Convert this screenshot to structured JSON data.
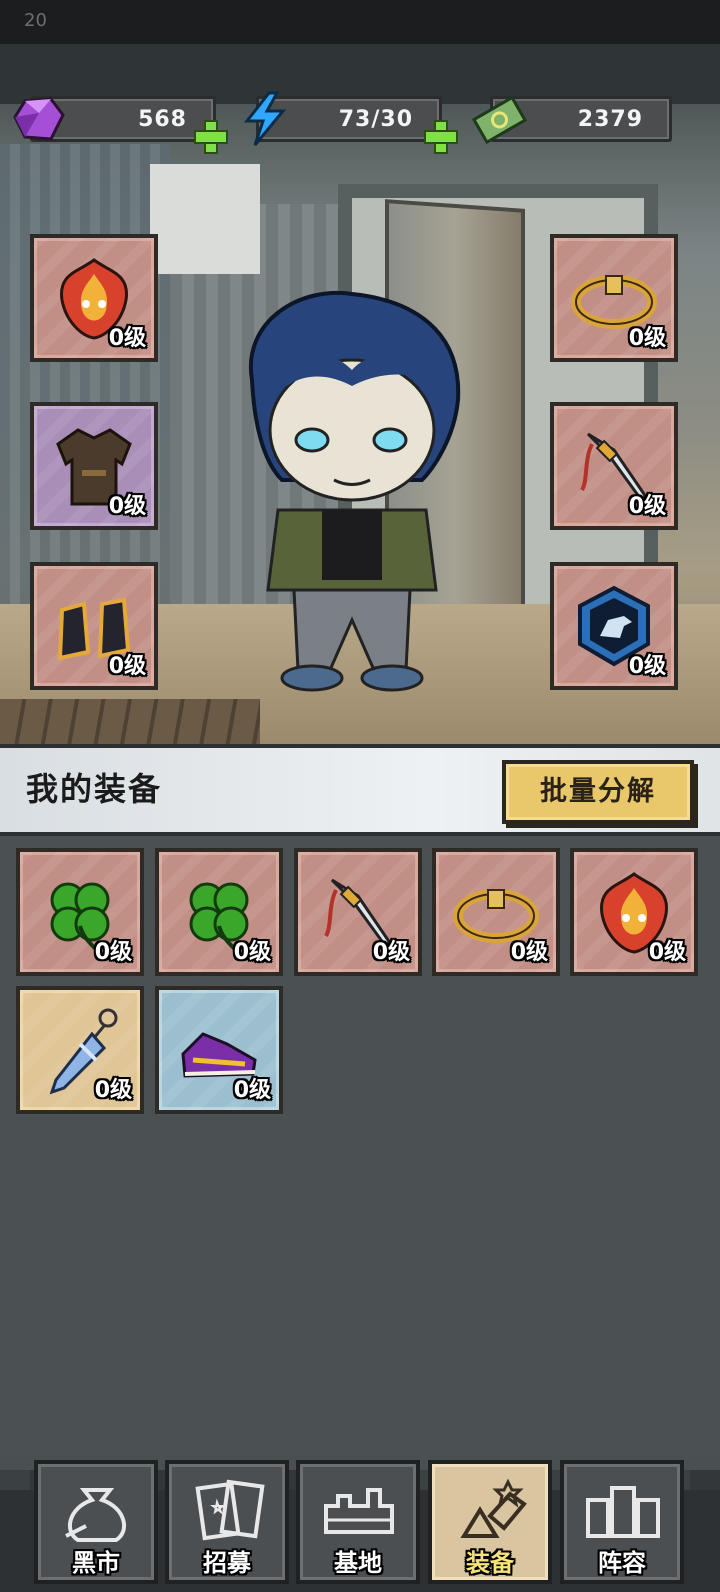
{
  "status_bar": {
    "time": "20"
  },
  "resources": [
    {
      "name": "gems",
      "icon": "purple-gem-icon",
      "value": "568"
    },
    {
      "name": "energy",
      "icon": "lightning-icon",
      "value": "73/30"
    },
    {
      "name": "cash",
      "icon": "banknote-icon",
      "value": "2379"
    }
  ],
  "equipped": {
    "left": [
      {
        "item": "flame-mask",
        "level": "0级",
        "rarity": "red"
      },
      {
        "item": "jacket",
        "level": "0级",
        "rarity": "purple"
      },
      {
        "item": "boots",
        "level": "0级",
        "rarity": "red"
      }
    ],
    "right": [
      {
        "item": "gold-bracelet",
        "level": "0级",
        "rarity": "red"
      },
      {
        "item": "ornate-dagger",
        "level": "0级",
        "rarity": "red"
      },
      {
        "item": "dino-pendant",
        "level": "0级",
        "rarity": "red"
      }
    ]
  },
  "inventory": {
    "title": "我的装备",
    "batch_button": "批量分解",
    "items": [
      {
        "item": "four-leaf-clover",
        "level": "0级",
        "rarity": "red"
      },
      {
        "item": "four-leaf-clover",
        "level": "0级",
        "rarity": "red"
      },
      {
        "item": "ornate-dagger",
        "level": "0级",
        "rarity": "red"
      },
      {
        "item": "gold-bracelet",
        "level": "0级",
        "rarity": "red"
      },
      {
        "item": "flame-mask",
        "level": "0级",
        "rarity": "red"
      },
      {
        "item": "ice-blade-keychain",
        "level": "0级",
        "rarity": "gold"
      },
      {
        "item": "sneakers",
        "level": "0级",
        "rarity": "blue"
      }
    ]
  },
  "nav": {
    "tabs": [
      {
        "label": "黑市",
        "icon": "money-bag-icon",
        "active": false
      },
      {
        "label": "招募",
        "icon": "cards-icon",
        "active": false
      },
      {
        "label": "基地",
        "icon": "base-icon",
        "active": false
      },
      {
        "label": "装备",
        "icon": "equipment-icon",
        "active": true
      },
      {
        "label": "阵容",
        "icon": "lineup-icon",
        "active": false
      }
    ]
  }
}
